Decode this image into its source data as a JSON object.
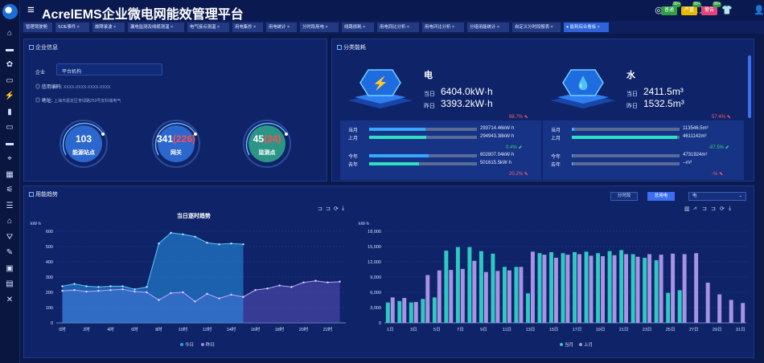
{
  "app": {
    "title": "AcrelEMS企业微电网能效管理平台",
    "header_badges": [
      {
        "label": "普通",
        "count": "99+",
        "color": "#2ea043"
      },
      {
        "label": "严重",
        "count": "99+",
        "color": "#e6b800"
      },
      {
        "label": "警告",
        "count": "99+",
        "color": "#e0457b"
      }
    ],
    "header_icons": [
      "target-icon",
      "search-icon",
      "refresh-icon",
      "fullscreen-icon",
      "image-icon",
      "shirt-icon",
      "user-icon"
    ]
  },
  "sidebar": {
    "icons": [
      "home-icon",
      "minus-icon",
      "gear-icon",
      "laptop-icon",
      "bolt-icon",
      "bar-chart-icon",
      "monitor-icon",
      "tv-icon",
      "location-icon",
      "grid-icon",
      "plug-icon",
      "list-icon",
      "alarm-icon",
      "bell-icon",
      "edit-icon",
      "layer-icon",
      "file-icon",
      "tools-icon"
    ]
  },
  "tabs": [
    {
      "label": "管理驾驶舱"
    },
    {
      "label": "SOE事件 ×"
    },
    {
      "label": "故障录波 ×"
    },
    {
      "label": "漏电监测及线缆测温 ×"
    },
    {
      "label": "电气接点测温 ×"
    },
    {
      "label": "用电集抄 ×"
    },
    {
      "label": "用电统计 ×"
    },
    {
      "label": "分时段用电 ×"
    },
    {
      "label": "线路损耗 ×"
    },
    {
      "label": "用电同比分析 ×"
    },
    {
      "label": "用电环比分析 ×"
    },
    {
      "label": "分组用能统计 ×"
    },
    {
      "label": "自定义分时段报表 ×"
    },
    {
      "label": "● 能耗综合看板 ×"
    }
  ],
  "company": {
    "title": "企业信息",
    "enterprise_label": "企业",
    "enterprise_value": "平台机构",
    "credit_label": "信用编码:",
    "credit_value": "XXXX-XXXX-XXXX-XXXX",
    "address_label": "地址:",
    "address_value": "上海市嘉定区育绿路253号安科瑞电气",
    "rings": [
      {
        "value": "103",
        "extra": "",
        "label": "能源站点",
        "color": "#2f6fd8"
      },
      {
        "value": "341",
        "extra": "(226)",
        "label": "网关",
        "color": "#2f6fd8"
      },
      {
        "value": "45",
        "extra": "(34)",
        "label": "监测点",
        "color": "#2fa38a"
      }
    ]
  },
  "energy": {
    "title": "分类能耗",
    "electric": {
      "name": "电",
      "today_label": "当日",
      "today_value": "6404.0kW·h",
      "yesterday_label": "昨日",
      "yesterday_value": "3393.2kW·h",
      "pct1": "88.7%",
      "month_label": "当月",
      "month_value": "293714.46kW·h",
      "month_fill": 0.52,
      "lastmonth_label": "上月",
      "lastmonth_value": "294943.38kW·h",
      "lastmonth_fill": 0.53,
      "pct2": "0.4%",
      "year_label": "今年",
      "year_value": "602807.04kW·h",
      "year_fill": 0.55,
      "lastyear_label": "去年",
      "lastyear_value": "501615.5kW·h",
      "lastyear_fill": 0.46,
      "pct3": "20.2%"
    },
    "water": {
      "name": "水",
      "today_label": "当日",
      "today_value": "2411.5m³",
      "yesterday_label": "昨日",
      "yesterday_value": "1532.5m³",
      "pct1": "57.4%",
      "month_label": "当月",
      "month_value": "113546.5m³",
      "month_fill": 0.02,
      "lastmonth_label": "上月",
      "lastmonth_value": "4611142m³",
      "lastmonth_fill": 0.98,
      "pct2": "-97.5%",
      "year_label": "今年",
      "year_value": "4731924m³",
      "year_fill": 0.0,
      "lastyear_label": "去年",
      "lastyear_value": "--m³",
      "lastyear_fill": 0.0,
      "pct3": "-%"
    }
  },
  "trend": {
    "title": "用能趋势",
    "btn_period": "分时段",
    "btn_power": "总用电",
    "select_value": "电"
  },
  "chart_data": [
    {
      "type": "area",
      "title": "当日逐时趋势",
      "ylabel": "kW·h",
      "ylim": [
        0,
        600
      ],
      "yticks": [
        "0",
        "100",
        "200",
        "300",
        "400",
        "500",
        "600"
      ],
      "x": [
        "0时",
        "1时",
        "2时",
        "3时",
        "4时",
        "5时",
        "6时",
        "7时",
        "8时",
        "9时",
        "10时",
        "11时",
        "12时",
        "13时",
        "14时",
        "15时",
        "16时",
        "17时",
        "18时",
        "19时",
        "20时",
        "21时",
        "22时",
        "23时"
      ],
      "xtick_labels": [
        "0时",
        "2时",
        "4时",
        "6时",
        "8时",
        "10时",
        "12时",
        "14时",
        "16时",
        "18时",
        "20时",
        "22时"
      ],
      "series": [
        {
          "name": "今日",
          "color": "#2a9df4",
          "values": [
            240,
            255,
            240,
            235,
            240,
            240,
            220,
            235,
            520,
            590,
            580,
            565,
            525,
            515,
            520,
            515,
            null,
            null,
            null,
            null,
            null,
            null,
            null,
            null
          ]
        },
        {
          "name": "昨日",
          "color": "#9d86e6",
          "values": [
            210,
            215,
            205,
            210,
            215,
            220,
            205,
            200,
            150,
            195,
            200,
            140,
            190,
            160,
            185,
            170,
            215,
            225,
            245,
            235,
            265,
            275,
            265,
            270
          ]
        }
      ]
    },
    {
      "type": "bar",
      "ylabel": "kW·h",
      "ylim": [
        0,
        18000
      ],
      "yticks": [
        "0",
        "3,000",
        "6,000",
        "9,000",
        "12,000",
        "15,000",
        "18,000"
      ],
      "categories": [
        "1日",
        "2日",
        "3日",
        "4日",
        "5日",
        "6日",
        "7日",
        "8日",
        "9日",
        "10日",
        "11日",
        "12日",
        "13日",
        "14日",
        "15日",
        "16日",
        "17日",
        "18日",
        "19日",
        "20日",
        "21日",
        "22日",
        "23日",
        "24日",
        "25日",
        "26日",
        "27日",
        "28日",
        "29日",
        "30日",
        "31日"
      ],
      "xtick_labels": [
        "1日",
        "3日",
        "5日",
        "7日",
        "9日",
        "11日",
        "13日",
        "15日",
        "17日",
        "19日",
        "21日",
        "23日",
        "25日",
        "27日",
        "29日",
        "31日"
      ],
      "series": [
        {
          "name": "当月",
          "color": "#2fc9c2",
          "values": [
            4000,
            4300,
            4000,
            4700,
            5000,
            14200,
            14900,
            14900,
            14100,
            13600,
            11000,
            11000,
            5800,
            13700,
            13900,
            13700,
            13900,
            14000,
            13700,
            14100,
            14300,
            13500,
            12800,
            12300,
            5900,
            6400,
            0,
            0,
            0,
            0,
            0
          ]
        },
        {
          "name": "上月",
          "color": "#a892e6",
          "values": [
            5000,
            4900,
            4100,
            9400,
            10300,
            10400,
            10600,
            12200,
            10000,
            10200,
            10300,
            11000,
            14000,
            13400,
            12800,
            13400,
            13500,
            13200,
            13100,
            13300,
            13500,
            13000,
            13500,
            13400,
            13600,
            13500,
            13700,
            7900,
            5600,
            4500,
            3900
          ]
        }
      ]
    }
  ]
}
